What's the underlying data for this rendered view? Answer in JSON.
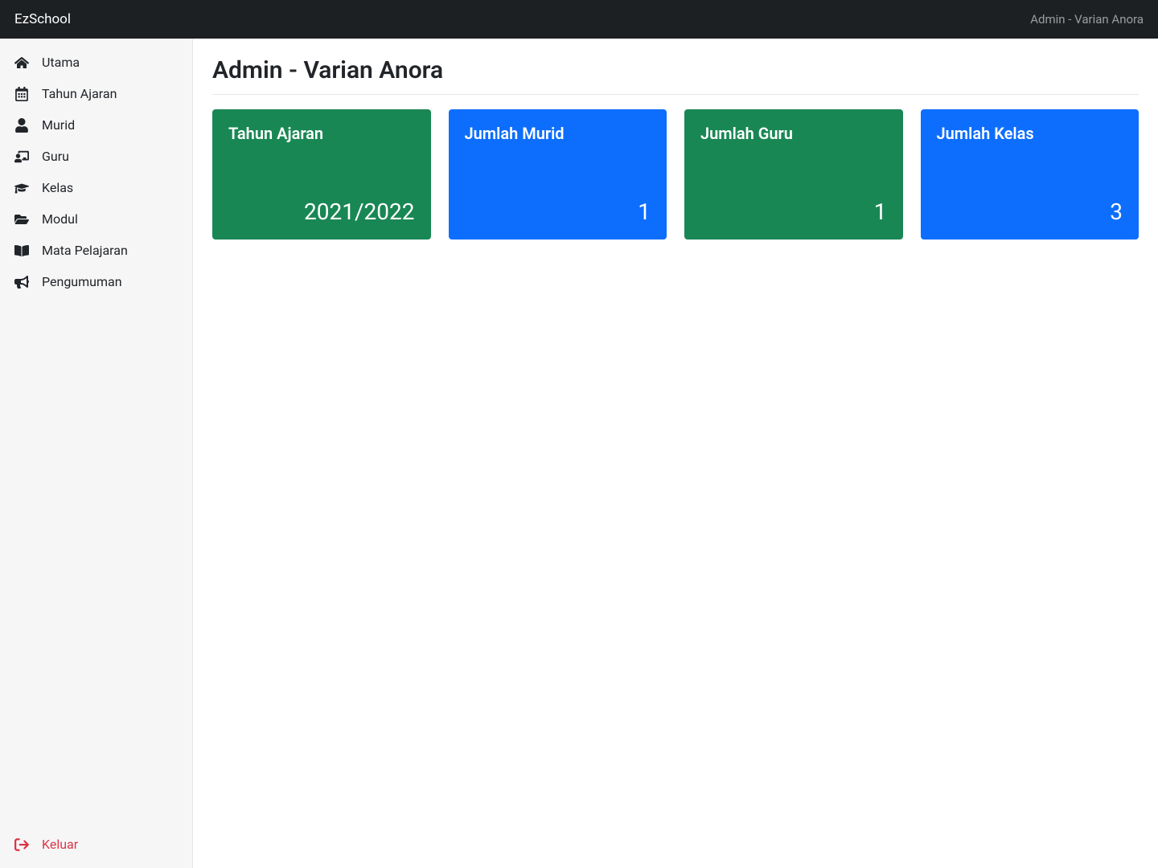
{
  "brand": "EzSchool",
  "topbar": {
    "user_label": "Admin - Varian Anora"
  },
  "sidebar": {
    "items": [
      {
        "label": "Utama",
        "icon": "home"
      },
      {
        "label": "Tahun Ajaran",
        "icon": "calendar"
      },
      {
        "label": "Murid",
        "icon": "user"
      },
      {
        "label": "Guru",
        "icon": "teacher"
      },
      {
        "label": "Kelas",
        "icon": "graduation"
      },
      {
        "label": "Modul",
        "icon": "folder"
      },
      {
        "label": "Mata Pelajaran",
        "icon": "book"
      },
      {
        "label": "Pengumuman",
        "icon": "bullhorn"
      }
    ],
    "logout": {
      "label": "Keluar",
      "icon": "signout"
    }
  },
  "main": {
    "title": "Admin - Varian Anora",
    "cards": [
      {
        "title": "Tahun Ajaran",
        "value": "2021/2022",
        "color": "green"
      },
      {
        "title": "Jumlah Murid",
        "value": "1",
        "color": "blue"
      },
      {
        "title": "Jumlah Guru",
        "value": "1",
        "color": "green"
      },
      {
        "title": "Jumlah Kelas",
        "value": "3",
        "color": "blue"
      }
    ]
  }
}
